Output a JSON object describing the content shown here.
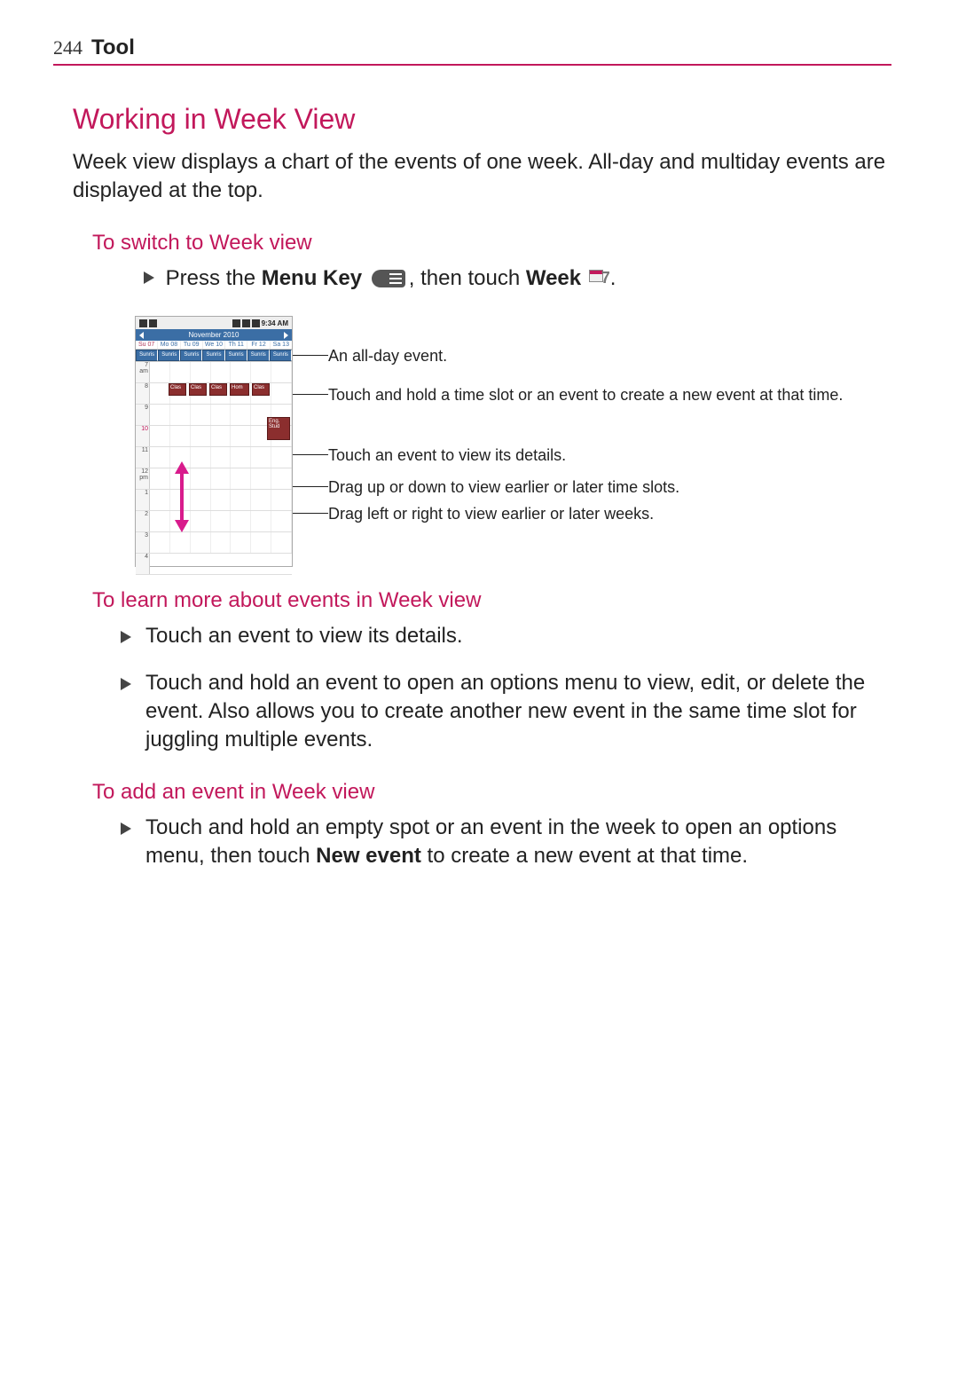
{
  "header": {
    "page_number": "244",
    "section": "Tool"
  },
  "main": {
    "title": "Working in Week View",
    "intro": "Week view displays a chart of the events of one week. All-day and multiday events are displayed at the top."
  },
  "switch": {
    "heading": "To switch to Week view",
    "press_the": "Press the ",
    "menu_key_label": "Menu Key",
    "then_touch": ", then touch ",
    "week_label": "Week",
    "period": "."
  },
  "figure": {
    "status_time": "9:34 AM",
    "month": "November 2010",
    "days": [
      "Su 07",
      "Mo 08",
      "Tu 09",
      "We 10",
      "Th 11",
      "Fr 12",
      "Sa 13"
    ],
    "allday_label": "Sunris",
    "hours": [
      "7",
      "8",
      "9",
      "10",
      "11",
      "12",
      "1",
      "2",
      "3",
      "4"
    ],
    "hour_suffix_am": "am",
    "hour_suffix_pm": "pm",
    "events": [
      "Clas",
      "Clas",
      "Clas",
      "Hom",
      "Clas"
    ],
    "event_big": "Eng. Stud"
  },
  "callouts": {
    "c1": "An all-day event.",
    "c2": "Touch and hold a time slot or an event to create a new event at that time.",
    "c3": "Touch an event to view its details.",
    "c4": "Drag up or down to view earlier or later time slots.",
    "c5": "Drag left or right to view earlier or later weeks."
  },
  "learn": {
    "heading": "To learn more about events in Week view",
    "item1": "Touch an event to view its details.",
    "item2": "Touch and hold an event to open an options menu to view, edit, or delete the event. Also allows you to create another new event in the same time slot for juggling multiple events."
  },
  "add": {
    "heading": "To add an event in Week view",
    "item1_a": "Touch and hold an empty spot or an event in the week to open an options menu, then touch ",
    "item1_bold": "New event",
    "item1_b": " to create a new event at that time."
  }
}
